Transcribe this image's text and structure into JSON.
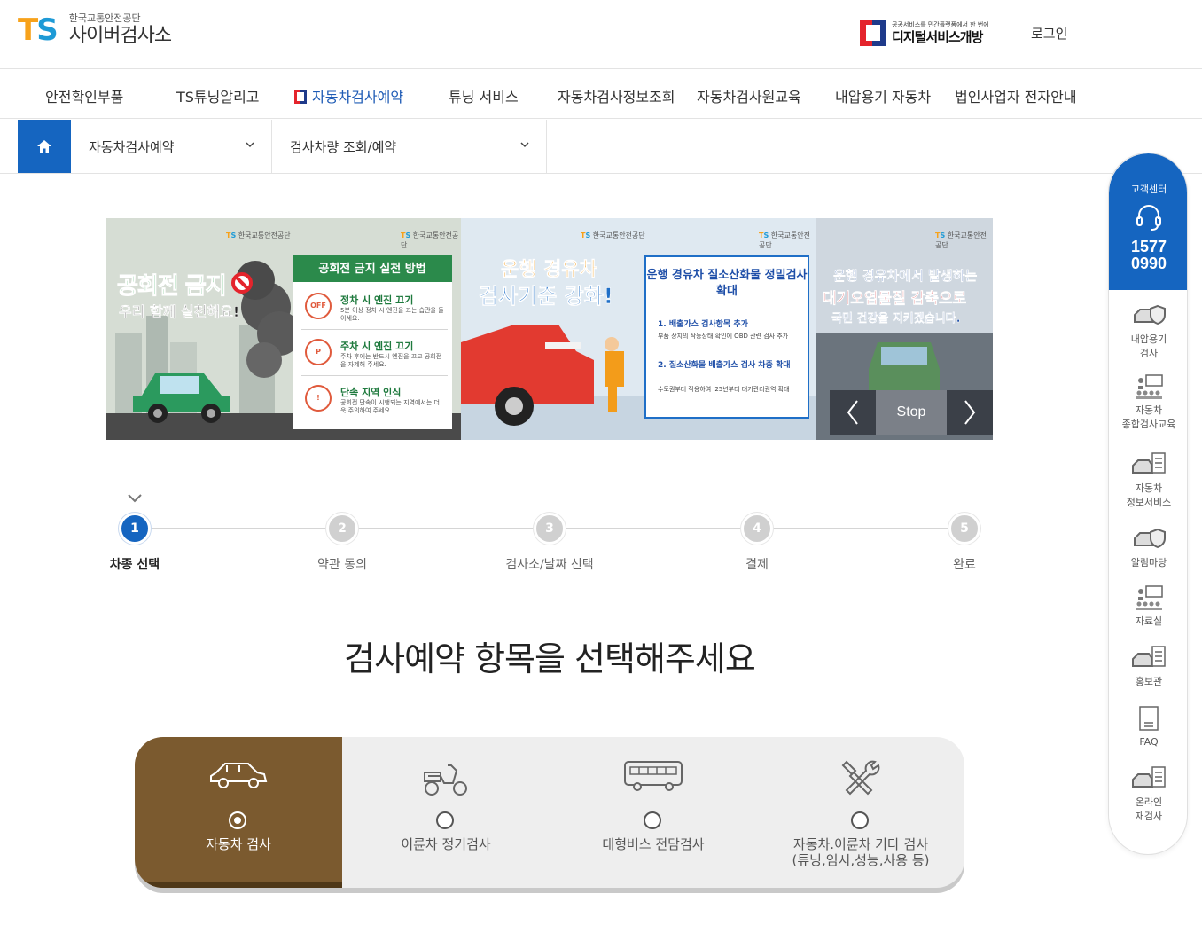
{
  "header": {
    "logo_mark_t": "T",
    "logo_mark_s": "S",
    "logo_sub": "한국교통안전공단",
    "logo_main": "사이버검사소",
    "digital_sub": "공공서비스를 민간플랫폼에서 한 번에",
    "digital_main": "디지털서비스개방",
    "login": "로그인"
  },
  "gnb": [
    {
      "label": "안전확인부품"
    },
    {
      "label": "TS튜닝알리고"
    },
    {
      "label": "자동차검사예약",
      "active": true
    },
    {
      "label": "튜닝 서비스"
    },
    {
      "label": "자동차검사정보조회"
    },
    {
      "label": "자동차검사원교육"
    },
    {
      "label": "내압용기 자동차"
    },
    {
      "label": "법인사업자 전자안내"
    }
  ],
  "location": {
    "home_icon": "home-icon",
    "depth1": "자동차검사예약",
    "depth2": "검사차량 조회/예약"
  },
  "banner": {
    "ts_label": "한국교통안전공단",
    "slide1": {
      "title": "공회전 금지",
      "subtitle": "우리 함께 실천해요!",
      "panel_title": "공회전 금지 실천 방법",
      "rows": [
        {
          "badge": "OFF",
          "title": "정차 시 엔진 끄기",
          "desc": "5분 이상 정차 시 엔진을 끄는 습관을 들이세요."
        },
        {
          "badge": "P",
          "title": "주차 시 엔진 끄기",
          "desc": "주차 후에는 반드시 엔진을 끄고 공회전을 자제해 주세요."
        },
        {
          "badge": "!",
          "title": "단속 지역 인식",
          "desc": "공회전 단속이 시행되는 지역에서는 더욱 주의하여 주세요."
        }
      ]
    },
    "slide2": {
      "title1": "운행 경유차",
      "title2": "검사기준 강화!",
      "panel_title": "운행 경유차 질소산화물 정밀검사 확대",
      "item1_title": "1. 배출가스 검사항목 추가",
      "item1_desc": "부품 장치의 작동상태 확인에 OBD 관련 검사 추가",
      "item2_title": "2. 질소산화물 배출가스 검사 차종 확대",
      "item2_desc": "수도권부터 적용하여 '25년부터 대기관리권역 확대"
    },
    "slide3": {
      "t1": "운행 경유차에서 발생하는",
      "t2": "대기오염물질 감축으로",
      "t3": "국민 건강을 지키겠습니다."
    },
    "controls": {
      "stop": "Stop",
      "prev_icon": "chevron-left-icon",
      "next_icon": "chevron-right-icon"
    }
  },
  "steps": [
    {
      "num": "1",
      "label": "차종 선택",
      "active": true
    },
    {
      "num": "2",
      "label": "약관 동의"
    },
    {
      "num": "3",
      "label": "검사소/날짜 선택"
    },
    {
      "num": "4",
      "label": "결제"
    },
    {
      "num": "5",
      "label": "완료"
    }
  ],
  "main_title": "검사예약 항목을 선택해주세요",
  "options": [
    {
      "label": "자동차 검사",
      "icon": "car-icon",
      "selected": true
    },
    {
      "label": "이륜차 정기검사",
      "icon": "motorcycle-icon"
    },
    {
      "label": "대형버스 전담검사",
      "icon": "bus-icon"
    },
    {
      "label": "자동차.이륜차 기타 검사\n(튜닝,임시,성능,사용 등)",
      "icon": "tools-icon"
    }
  ],
  "quick": {
    "title": "고객센터",
    "phone1": "1577",
    "phone2": "0990",
    "items": [
      {
        "label": "내압용기\n검사",
        "icon": "car-shield-icon"
      },
      {
        "label": "자동차\n종합검사교육",
        "icon": "classroom-icon"
      },
      {
        "label": "자동차\n정보서비스",
        "icon": "car-checklist-icon"
      },
      {
        "label": "알림마당",
        "icon": "car-shield-icon"
      },
      {
        "label": "자료실",
        "icon": "classroom-icon"
      },
      {
        "label": "홍보관",
        "icon": "car-checklist-icon"
      },
      {
        "label": "FAQ",
        "icon": "document-icon"
      },
      {
        "label": "온라인\n재검사",
        "icon": "car-checklist-icon"
      }
    ]
  }
}
